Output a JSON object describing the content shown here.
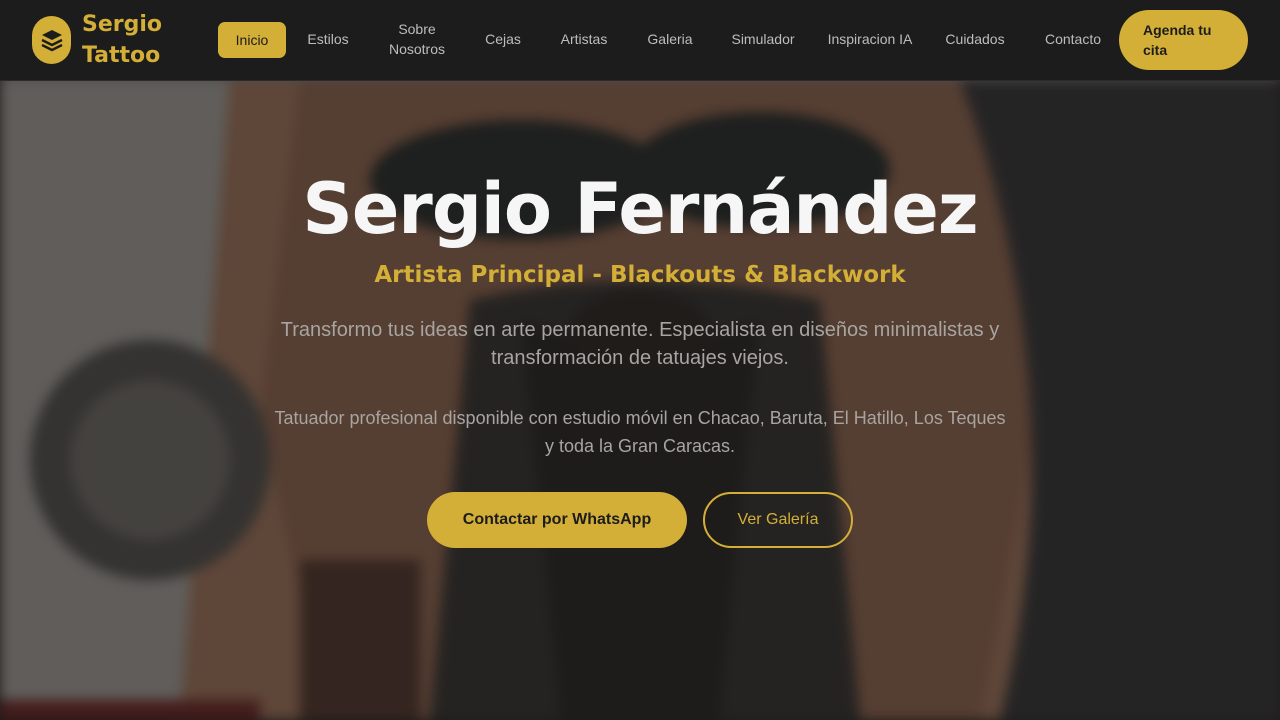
{
  "brand": {
    "name": "Sergio Tattoo",
    "logo_icon": "layers-icon",
    "accent_color": "#d4af37"
  },
  "nav": {
    "items": [
      {
        "label": "Inicio",
        "active": true
      },
      {
        "label": "Estilos"
      },
      {
        "label": "Sobre Nosotros"
      },
      {
        "label": "Cejas"
      },
      {
        "label": "Artistas"
      },
      {
        "label": "Galeria"
      },
      {
        "label": "Simulador"
      },
      {
        "label": "Inspiracion IA"
      },
      {
        "label": "Cuidados"
      },
      {
        "label": "Contacto"
      }
    ],
    "cta_label": "Agenda tu cita"
  },
  "hero": {
    "title": "Sergio Fernández",
    "subtitle": "Artista Principal - Blackouts & Blackwork",
    "description": "Transformo tus ideas en arte permanente. Especialista en diseños minimalistas y transformación de tatuajes viejos.",
    "description_2": "Tatuador profesional disponible con estudio móvil en Chacao, Baruta, El Hatillo, Los Teques y toda la Gran Caracas.",
    "primary_button": "Contactar por WhatsApp",
    "secondary_button": "Ver Galería"
  }
}
